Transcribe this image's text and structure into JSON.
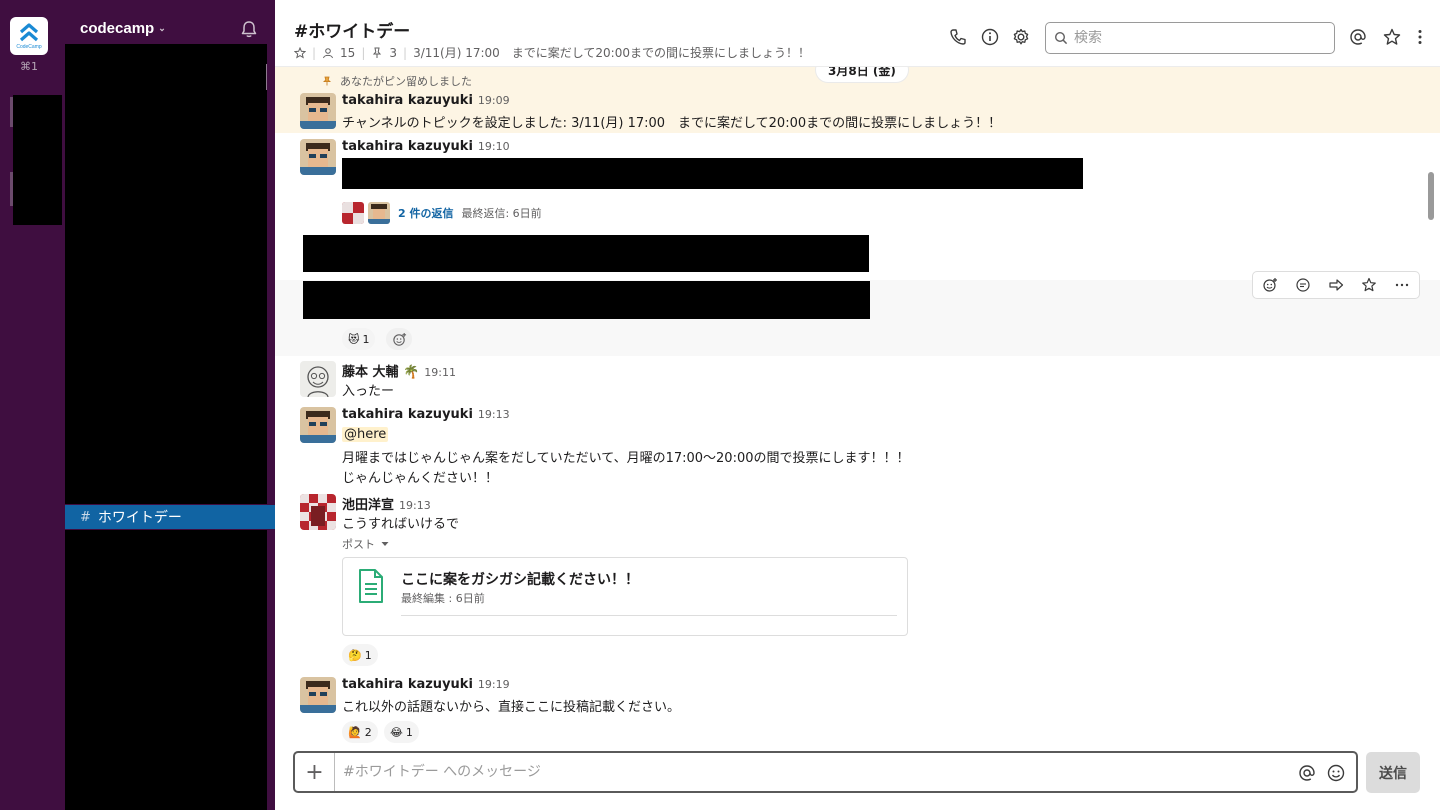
{
  "workspace": {
    "name": "codecamp",
    "shortcut": "⌘1",
    "logo_text": "CodeCamp"
  },
  "sidebar": {
    "active_channel": "ホワイトデー",
    "hash": "#"
  },
  "header": {
    "channel_title": "#ホワイトデー",
    "members_count": "15",
    "pins_count": "3",
    "topic": "3/11(月)  17:00　までに案だして20:00までの間に投票にしましょう！！",
    "search_placeholder": "検索"
  },
  "date_divider": "3月8日 (金)",
  "messages": [
    {
      "pin_note": "あなたがピン留めしました",
      "author": "takahira kazuyuki",
      "time": "19:09",
      "text": "チャンネルのトピックを設定しました: 3/11(月)  17:00　までに案だして20:00までの間に投票にしましょう！！"
    },
    {
      "author": "takahira kazuyuki",
      "time": "19:10",
      "thread_replies": "2 件の返信",
      "thread_last": "最終返信: 6日前"
    },
    {
      "reaction_count": "1",
      "reaction_emoji": "😻"
    },
    {
      "author": "藤本 大輔",
      "author_badge": "🌴",
      "time": "19:11",
      "text": "入ったー"
    },
    {
      "author": "takahira kazuyuki",
      "time": "19:13",
      "mention": "@here",
      "line1": "月曜まではじゃんじゃん案をだしていただいて、月曜の17:00〜20:00の間で投票にします！！！",
      "line2": "じゃんじゃんください！！"
    },
    {
      "author": "池田洋宣",
      "time": "19:13",
      "text": "こうすればいけるで",
      "post_label": "ポスト",
      "post_title": "ここに案をガシガシ記載ください！！",
      "post_edited": "最終編集 : 6日前",
      "reaction_emoji": "🤔",
      "reaction_count": "1"
    },
    {
      "author": "takahira kazuyuki",
      "time": "19:19",
      "text": "これ以外の話題ないから、直接ここに投稿記載ください。",
      "reactions": [
        {
          "emoji": "🙋",
          "count": "2"
        },
        {
          "emoji": "😂",
          "count": "1"
        }
      ]
    }
  ],
  "composer": {
    "placeholder": "#ホワイトデー へのメッセージ",
    "send_label": "送信"
  },
  "icons": {
    "phone": "phone-icon",
    "info": "info-icon",
    "settings": "gear-icon",
    "mentions": "at-sign-icon",
    "star": "star-icon",
    "more": "more-vertical-icon"
  },
  "colors": {
    "sidebar_bg": "#3f0e40",
    "active_channel_bg": "#1164a3",
    "pinned_bg": "#fdf5e4",
    "link": "#1264a3"
  }
}
